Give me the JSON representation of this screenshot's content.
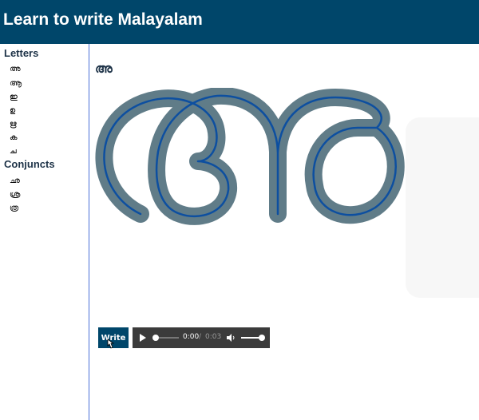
{
  "header": {
    "title": "Learn to write Malayalam"
  },
  "sidebar": {
    "letters_title": "Letters",
    "letters": [
      "അ",
      "ആ",
      "ഇ",
      "ഉ",
      "ഋ",
      "ക",
      "ച"
    ],
    "conjuncts_title": "Conjuncts",
    "conjuncts": [
      "ഛ",
      "ശ്ര",
      "ത്ര"
    ]
  },
  "main": {
    "current_letter": "അ",
    "write_label": "Write",
    "audio": {
      "current_time": "0:00",
      "separator": "/",
      "duration": "0:03",
      "progress": 0,
      "volume": 1.0
    }
  },
  "colors": {
    "header_bg": "#00466a",
    "stroke_outer": "#607c88",
    "stroke_inner": "#0d4fa0",
    "sidebar_border": "#4a6fd8"
  }
}
